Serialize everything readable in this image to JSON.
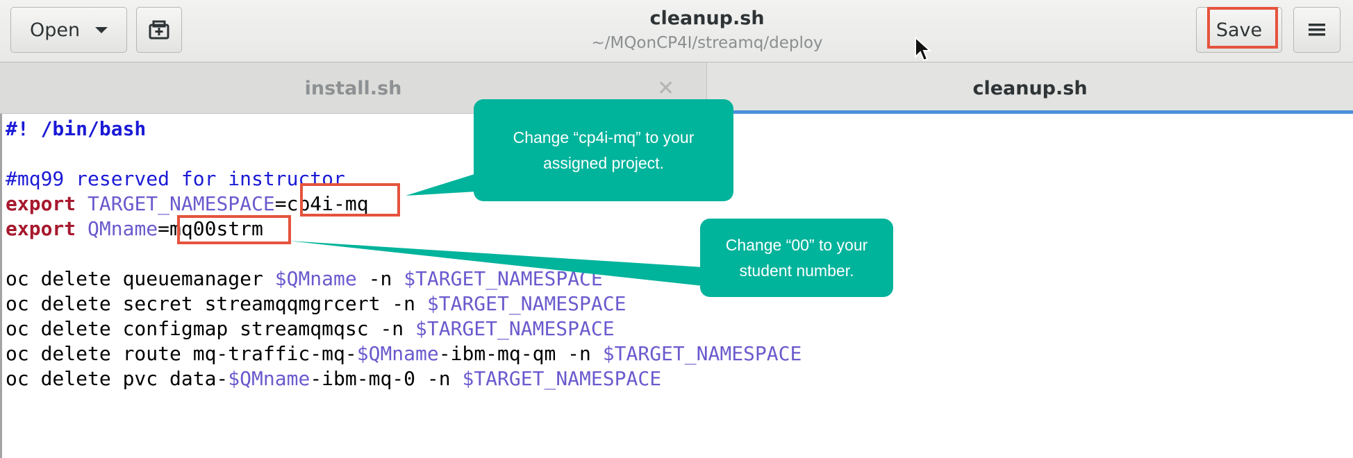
{
  "header": {
    "open_label": "Open",
    "save_label": "Save",
    "title": "cleanup.sh",
    "subtitle": "~/MQonCP4I/streamq/deploy",
    "icons": [
      "new-tab-icon",
      "hamburger-menu-icon",
      "chevron-down-icon"
    ]
  },
  "tabs": [
    {
      "label": "install.sh",
      "active": false
    },
    {
      "label": "cleanup.sh",
      "active": true
    }
  ],
  "editor": {
    "lines": {
      "l1": "#! /bin/bash",
      "l3": "#mq99 reserved for instructor",
      "l4_kw": "export",
      "l4_var": "TARGET_NAMESPACE",
      "l4_eq": "=",
      "l4_val": "cp4i-mq",
      "l5_kw": "export",
      "l5_var": "QMname",
      "l5_eq": "=",
      "l5_val": "mq00strm",
      "l7_a": "oc delete queuemanager ",
      "l7_b": "$QMname",
      "l7_c": " -n ",
      "l7_d": "$TARGET_NAMESPACE",
      "l8_a": "oc delete secret streamqqmgrcert -n ",
      "l8_b": "$TARGET_NAMESPACE",
      "l9_a": "oc delete configmap streamqmqsc -n ",
      "l9_b": "$TARGET_NAMESPACE",
      "l10_a": "oc delete route mq-traffic-mq-",
      "l10_b": "$QMname",
      "l10_c": "-ibm-mq-qm -n ",
      "l10_d": "$TARGET_NAMESPACE",
      "l11_a": "oc delete pvc data-",
      "l11_b": "$QMname",
      "l11_c": "-ibm-mq-0 -n ",
      "l11_d": "$TARGET_NAMESPACE"
    }
  },
  "callouts": {
    "c1_line1": "Change “cp4i-mq” to your",
    "c1_line2": "assigned project.",
    "c2_line1": "Change “00” to your",
    "c2_line2": "student number."
  },
  "colors": {
    "callout": "#00b39b",
    "highlight": "#e5533d",
    "keyword": "#a6192e",
    "variable": "#6a5acd",
    "comment": "#1a1ad6",
    "tab_indicator": "#4a90d9"
  }
}
